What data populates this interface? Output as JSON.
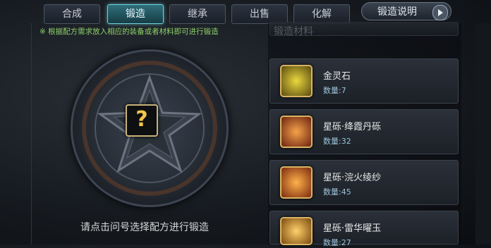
{
  "tabs": [
    {
      "label": "合成",
      "active": false
    },
    {
      "label": "锻造",
      "active": true
    },
    {
      "label": "继承",
      "active": false
    },
    {
      "label": "出售",
      "active": false
    },
    {
      "label": "化解",
      "active": false
    }
  ],
  "guide_button": {
    "label": "锻造说明"
  },
  "left": {
    "hint": "※ 根据配方需求放入相应的装备或者材料即可进行锻造",
    "slot_symbol": "?",
    "instruction": "请点击问号选择配方进行锻造"
  },
  "right": {
    "title": "锻造材料",
    "items": [
      {
        "name": "金灵石",
        "qty": "数量:7",
        "color": "#d6c23a"
      },
      {
        "name": "星砾·绛霞丹砾",
        "qty": "数量:32",
        "color": "#e06a2a"
      },
      {
        "name": "星砾·浣火绫纱",
        "qty": "数量:45",
        "color": "#f07a2a"
      },
      {
        "name": "星砾·雷华曜玉",
        "qty": "数量:27",
        "color": "#f0a43a"
      }
    ]
  },
  "colors": {
    "accent": "#6fd3dd",
    "hint_green": "#8fd06a",
    "gold": "#d9b463"
  }
}
